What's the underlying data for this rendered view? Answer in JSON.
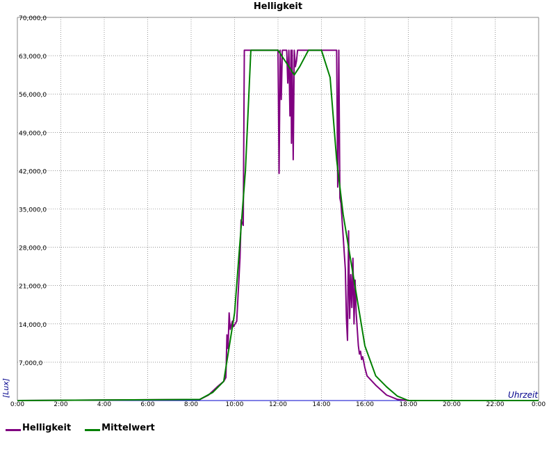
{
  "chart_data": {
    "type": "line",
    "title": "Helligkeit",
    "xlabel": "Uhrzeit",
    "ylabel": "[Lux]",
    "xlim": [
      0,
      24
    ],
    "ylim": [
      0,
      70000
    ],
    "grid": true,
    "legend_position": "bottom-left",
    "y_ticks": [
      "70,000,0",
      "63,000,0",
      "56,000,0",
      "49,000,0",
      "42,000,0",
      "35,000,0",
      "28,000,0",
      "21,000,0",
      "14,000,0",
      "7,000,0"
    ],
    "x_ticks": [
      "0:00",
      "2:00",
      "4:00",
      "6:00",
      "8:00",
      "10:00",
      "12:00",
      "14:00",
      "16:00",
      "18:00",
      "20:00",
      "22:00",
      "0:00"
    ],
    "series": [
      {
        "name": "Helligkeit",
        "color": "#800080",
        "x": [
          0,
          8.4,
          8.8,
          9.2,
          9.5,
          9.6,
          9.65,
          9.7,
          9.75,
          9.8,
          9.9,
          9.95,
          10.1,
          10.25,
          10.3,
          10.4,
          10.45,
          10.5,
          12.0,
          12.05,
          12.1,
          12.15,
          12.2,
          12.4,
          12.45,
          12.5,
          12.55,
          12.6,
          12.62,
          12.65,
          12.7,
          12.75,
          12.8,
          12.85,
          12.9,
          13.0,
          14.7,
          14.75,
          14.8,
          14.85,
          14.9,
          14.95,
          15.0,
          15.1,
          15.15,
          15.2,
          15.25,
          15.3,
          15.35,
          15.4,
          15.45,
          15.5,
          15.55,
          15.6,
          15.65,
          15.7,
          15.75,
          15.8,
          15.85,
          15.9,
          16.0,
          16.1,
          16.5,
          17.0,
          17.5,
          18.0,
          24
        ],
        "y": [
          0,
          200,
          1000,
          2500,
          3500,
          4200,
          12000,
          9500,
          16000,
          13000,
          14500,
          13500,
          14500,
          26000,
          33000,
          32000,
          64000,
          64000,
          64000,
          41500,
          64000,
          55000,
          64000,
          64000,
          58000,
          64000,
          52000,
          64000,
          47000,
          64000,
          44000,
          64000,
          61000,
          62000,
          64000,
          64000,
          64000,
          39000,
          64000,
          37000,
          36000,
          33000,
          30000,
          24000,
          15000,
          11000,
          31000,
          15000,
          23000,
          17000,
          26000,
          14000,
          22000,
          16000,
          13000,
          10000,
          8500,
          9000,
          7500,
          8000,
          6000,
          4500,
          2800,
          1000,
          200,
          0,
          0
        ]
      },
      {
        "name": "Mittelwert",
        "color": "#008000",
        "x": [
          0,
          8.4,
          9.0,
          9.5,
          10.0,
          10.5,
          10.75,
          12.0,
          12.5,
          12.75,
          13.0,
          13.4,
          14.0,
          14.4,
          14.7,
          15.0,
          15.5,
          16.0,
          16.5,
          17.0,
          17.5,
          18.0,
          24
        ],
        "y": [
          0,
          200,
          1500,
          3500,
          16000,
          42000,
          64000,
          64000,
          61000,
          59500,
          61000,
          64000,
          64000,
          59000,
          44000,
          34000,
          22000,
          10000,
          4500,
          2500,
          800,
          0,
          0
        ]
      }
    ]
  }
}
